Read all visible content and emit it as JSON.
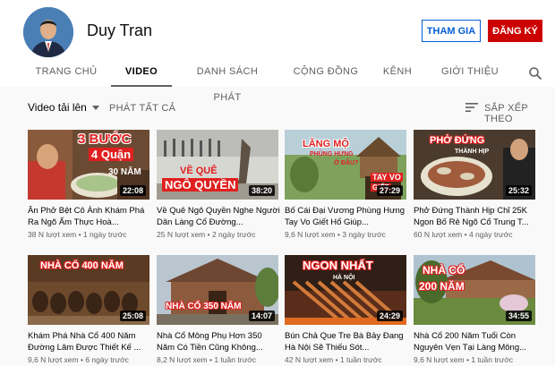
{
  "channel": {
    "name": "Duy Tran",
    "join_label": "THAM GIA",
    "subscribe_label": "ĐĂNG KÝ"
  },
  "tabs": [
    {
      "label": "TRANG CHỦ",
      "active": false
    },
    {
      "label": "VIDEO",
      "active": true
    },
    {
      "label": "DANH SÁCH PHÁT",
      "active": false
    },
    {
      "label": "CỘNG ĐỒNG",
      "active": false
    },
    {
      "label": "KÊNH",
      "active": false
    },
    {
      "label": "GIỚI THIỆU",
      "active": false
    }
  ],
  "toolbar": {
    "filter_label": "Video tải lên",
    "play_all_label": "PHÁT TẤT CẢ",
    "sort_label": "SẮP XẾP THEO"
  },
  "icons": {
    "search": "search-icon",
    "sort": "sort-icon",
    "caret": "caret-down-icon"
  },
  "colors": {
    "subscribe": "#cc0000",
    "join": "#065fd4"
  },
  "videos": [
    {
      "title": "Ăn Phở Bệt Cô Ánh Khám Phá Ra Ngõ Ẩm Thực Hoà...",
      "views": "38 N lượt xem",
      "age": "1 ngày trước",
      "duration": "22:08",
      "thumb_text": [
        "3 BƯỚC",
        "4 Quận",
        "30 NĂM"
      ]
    },
    {
      "title": "Về Quê Ngô Quyền Nghe Người Dân Làng Cổ Đường...",
      "views": "25 N lượt xem",
      "age": "2 ngày trước",
      "duration": "38:20",
      "thumb_text": [
        "VỀ QUÊ",
        "NGÔ QUYỀN"
      ]
    },
    {
      "title": "Bố Cái Đại Vương Phùng Hưng Tay Vo Giết Hổ Giúp...",
      "views": "9,6 N lượt xem",
      "age": "3 ngày trước",
      "duration": "27:29",
      "thumb_text": [
        "LĂNG MỘ",
        "PHÙNG HƯNG",
        "Ở ĐÂU?",
        "TAY VO",
        "GIẾT"
      ]
    },
    {
      "title": "Phở Đứng Thành Hịp Chỉ 25K Ngon Bố Rẻ Ngõ Cổ Trung T...",
      "views": "60 N lượt xem",
      "age": "4 ngày trước",
      "duration": "25:32",
      "thumb_text": [
        "PHỞ ĐỨNG",
        "THÀNH HỊP"
      ]
    },
    {
      "title": "Khám Phá Nhà Cổ 400 Năm Đường Lâm Được Thiết Kế ...",
      "views": "9,6 N lượt xem",
      "age": "6 ngày trước",
      "duration": "25:08",
      "thumb_text": [
        "NHÀ CỔ 400 NĂM"
      ]
    },
    {
      "title": "Nhà Cổ Mông Phụ Hơn 350 Năm Có Tiền Cũng Không...",
      "views": "8,2 N lượt xem",
      "age": "1 tuần trước",
      "duration": "14:07",
      "thumb_text": [
        "NHÀ CỔ 350 NĂM"
      ]
    },
    {
      "title": "Bún Chả Que Tre Bà Bảy Đang Hà Nội Sẽ Thiếu Sót...",
      "views": "42 N lượt xem",
      "age": "1 tuần trước",
      "duration": "24:29",
      "thumb_text": [
        "NGON NHẤT",
        "HÀ NỘI"
      ]
    },
    {
      "title": "Nhà Cổ 200 Năm Tuổi Còn Nguyên Vẹn Tại Làng Mông...",
      "views": "9,6 N lượt xem",
      "age": "1 tuần trước",
      "duration": "34:55",
      "thumb_text": [
        "NHÀ CỔ",
        "200 NĂM"
      ]
    }
  ]
}
